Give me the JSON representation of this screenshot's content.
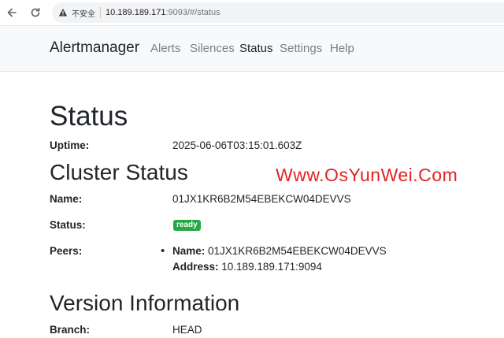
{
  "browser": {
    "security_label": "不安全",
    "url_host": "10.189.189.171",
    "url_rest": ":9093/#/status"
  },
  "navbar": {
    "brand": "Alertmanager",
    "links": [
      {
        "label": "Alerts"
      },
      {
        "label": "Silences"
      },
      {
        "label": "Status"
      },
      {
        "label": "Settings"
      },
      {
        "label": "Help"
      }
    ],
    "active": "Status"
  },
  "status": {
    "title": "Status",
    "uptime_label": "Uptime:",
    "uptime_value": "2025-06-06T03:15:01.603Z"
  },
  "cluster": {
    "title": "Cluster Status",
    "name_label": "Name:",
    "name_value": "01JX1KR6B2M54EBEKCW04DEVVS",
    "status_label": "Status:",
    "status_badge": "ready",
    "peers_label": "Peers:",
    "peer_name_key": "Name:",
    "peer_name_value": "01JX1KR6B2M54EBEKCW04DEVVS",
    "peer_address_key": "Address:",
    "peer_address_value": "10.189.189.171:9094"
  },
  "version": {
    "title": "Version Information",
    "branch_label": "Branch:",
    "branch_value": "HEAD"
  },
  "watermark": "Www.OsYunWei.Com",
  "colors": {
    "badge_ready": "#28a745",
    "watermark": "#e32222",
    "navbar_bg": "#f8f9fa"
  }
}
